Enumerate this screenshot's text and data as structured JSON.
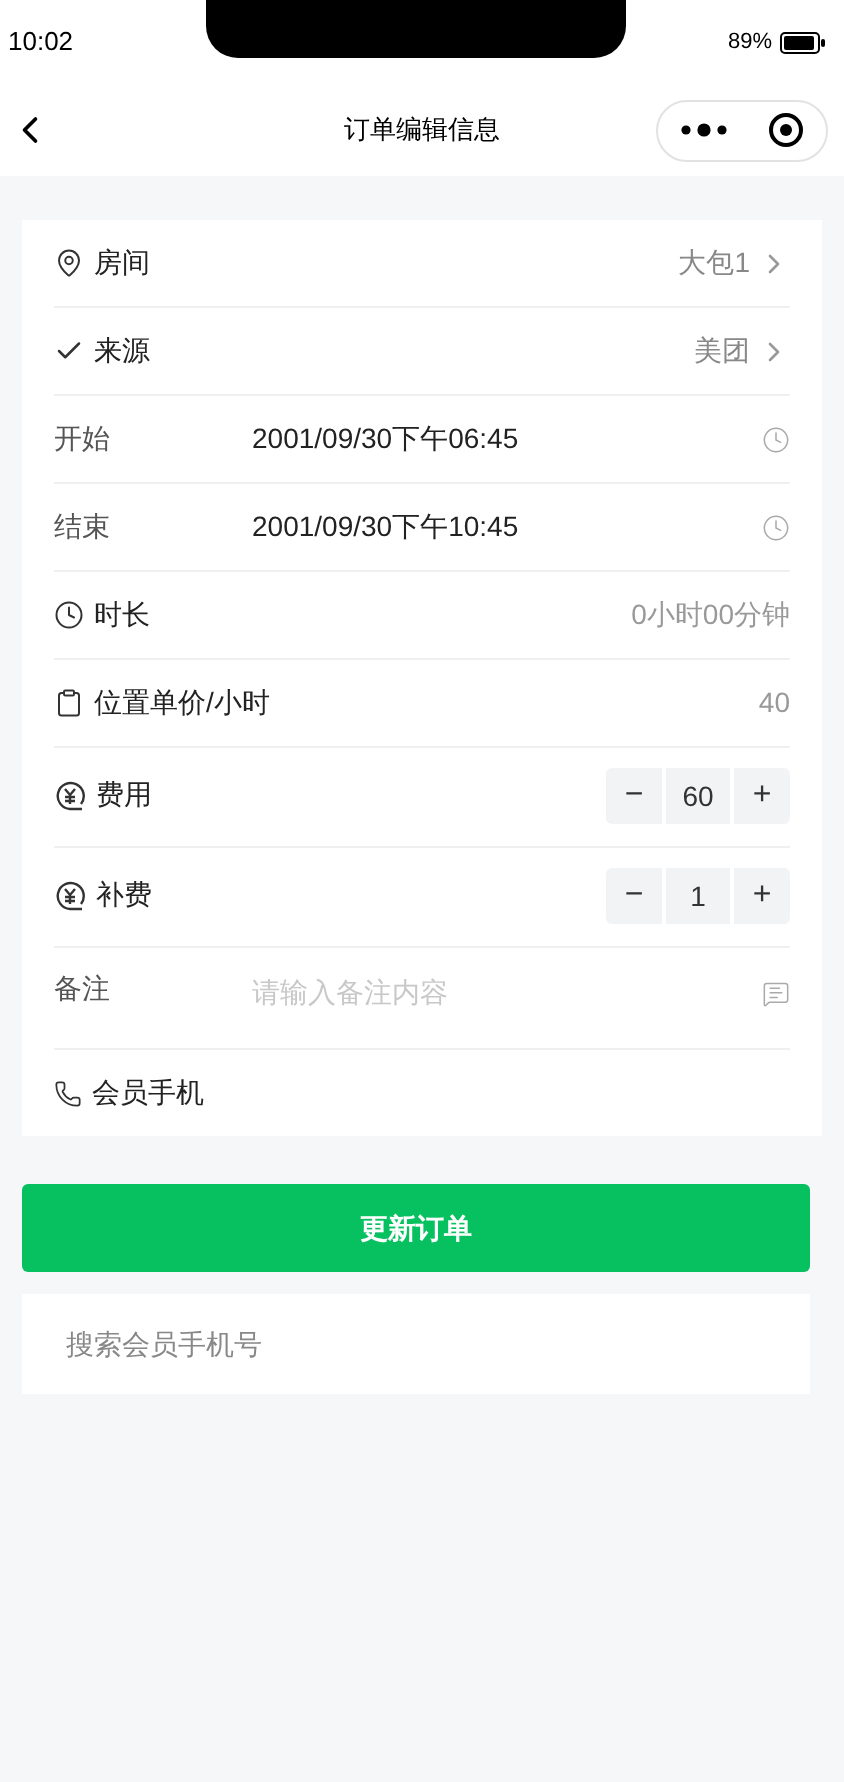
{
  "status_bar": {
    "time": "10:02",
    "battery": "89%"
  },
  "nav": {
    "title": "订单编辑信息"
  },
  "form": [
    {
      "kind": "select",
      "label": "房间",
      "value": "大包1"
    },
    {
      "kind": "select",
      "label": "来源",
      "value": "美团"
    },
    {
      "kind": "datetime",
      "label": "开始",
      "value": "2001/09/30下午06:45"
    },
    {
      "kind": "datetime",
      "label": "结束",
      "value": "2001/09/30下午10:45"
    },
    {
      "kind": "info",
      "label": "时长",
      "value": "0小时00分钟"
    },
    {
      "kind": "info",
      "label": "位置单价/小时",
      "value": "40"
    },
    {
      "kind": "stepper",
      "label": "费用",
      "value": "60",
      "minus": "−",
      "plus": "+"
    },
    {
      "kind": "stepper",
      "label": "补费",
      "value": "1",
      "minus": "−",
      "plus": "+"
    },
    {
      "kind": "textarea",
      "label": "备注",
      "placeholder": "请输入备注内容"
    },
    {
      "kind": "phone",
      "label": "会员手机"
    }
  ],
  "submit_button": "更新订单",
  "search": {
    "placeholder": "搜索会员手机号"
  }
}
